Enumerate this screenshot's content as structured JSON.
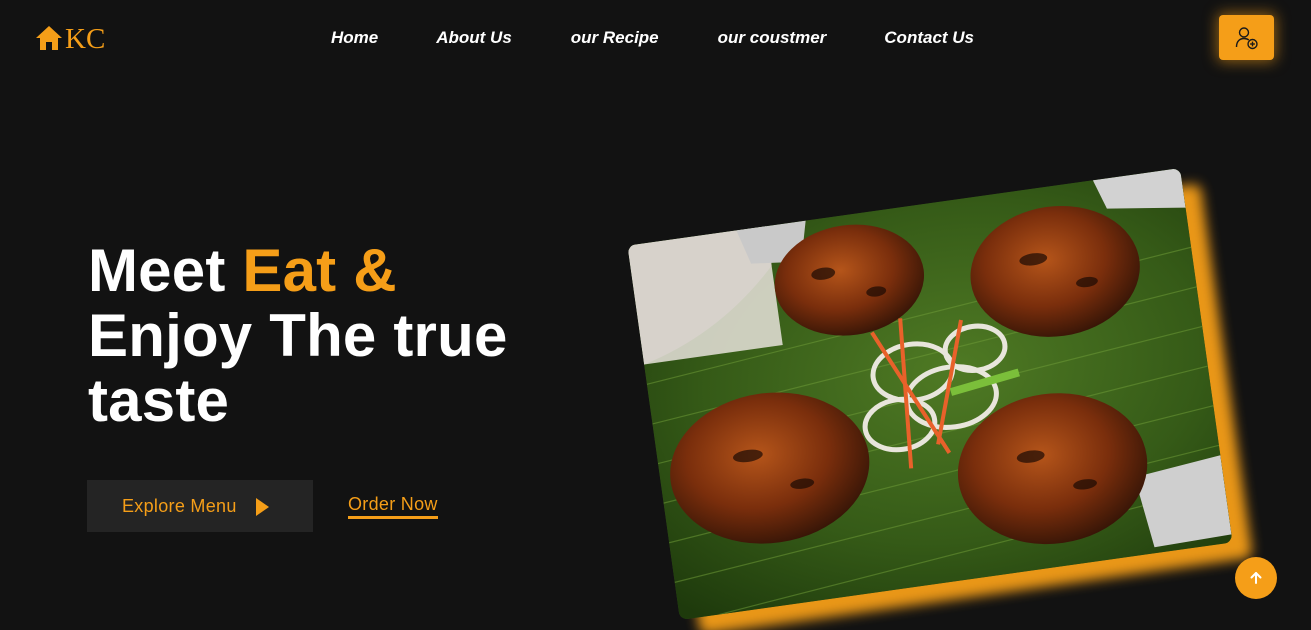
{
  "brand": {
    "logo_text": "KC",
    "logo_icon": "house-icon",
    "accent_color": "#f59e18",
    "background_color": "#121212"
  },
  "nav": {
    "items": [
      {
        "label": "Home"
      },
      {
        "label": "About Us"
      },
      {
        "label": "our Recipe"
      },
      {
        "label": "our coustmer"
      },
      {
        "label": "Contact Us"
      }
    ]
  },
  "header": {
    "user_button_icon": "user-add-icon"
  },
  "hero": {
    "title_part1": "Meet ",
    "title_accent": "Eat &",
    "title_line2": "Enjoy The true",
    "title_line3": "taste",
    "explore_label": "Explore Menu",
    "explore_icon": "play-icon",
    "order_label": "Order Now"
  },
  "hero_image": {
    "subject": "food-photo",
    "image_icon": "grilled-chicken-image"
  },
  "scroll_top": {
    "icon": "arrow-up-icon"
  }
}
